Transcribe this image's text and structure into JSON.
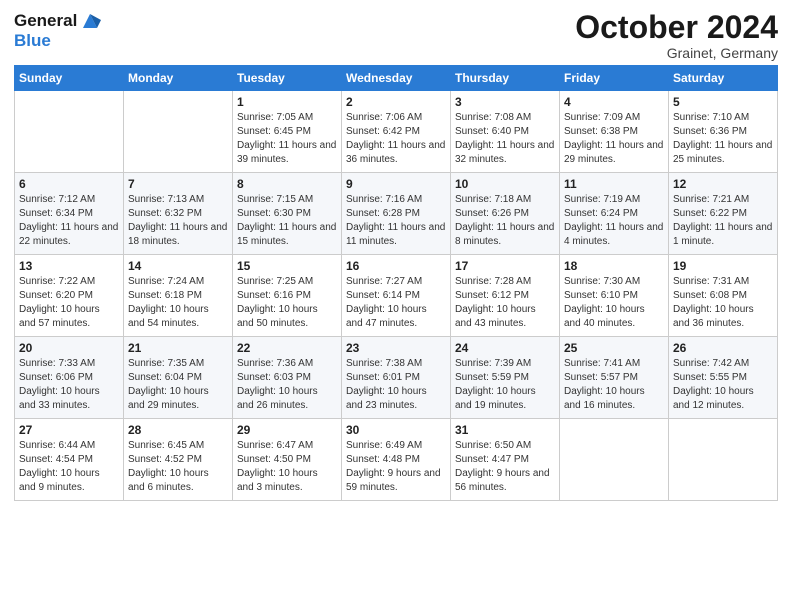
{
  "header": {
    "logo_line1": "General",
    "logo_line2": "Blue",
    "month": "October 2024",
    "location": "Grainet, Germany"
  },
  "weekdays": [
    "Sunday",
    "Monday",
    "Tuesday",
    "Wednesday",
    "Thursday",
    "Friday",
    "Saturday"
  ],
  "weeks": [
    [
      {
        "day": "",
        "content": ""
      },
      {
        "day": "",
        "content": ""
      },
      {
        "day": "1",
        "content": "Sunrise: 7:05 AM\nSunset: 6:45 PM\nDaylight: 11 hours and 39 minutes."
      },
      {
        "day": "2",
        "content": "Sunrise: 7:06 AM\nSunset: 6:42 PM\nDaylight: 11 hours and 36 minutes."
      },
      {
        "day": "3",
        "content": "Sunrise: 7:08 AM\nSunset: 6:40 PM\nDaylight: 11 hours and 32 minutes."
      },
      {
        "day": "4",
        "content": "Sunrise: 7:09 AM\nSunset: 6:38 PM\nDaylight: 11 hours and 29 minutes."
      },
      {
        "day": "5",
        "content": "Sunrise: 7:10 AM\nSunset: 6:36 PM\nDaylight: 11 hours and 25 minutes."
      }
    ],
    [
      {
        "day": "6",
        "content": "Sunrise: 7:12 AM\nSunset: 6:34 PM\nDaylight: 11 hours and 22 minutes."
      },
      {
        "day": "7",
        "content": "Sunrise: 7:13 AM\nSunset: 6:32 PM\nDaylight: 11 hours and 18 minutes."
      },
      {
        "day": "8",
        "content": "Sunrise: 7:15 AM\nSunset: 6:30 PM\nDaylight: 11 hours and 15 minutes."
      },
      {
        "day": "9",
        "content": "Sunrise: 7:16 AM\nSunset: 6:28 PM\nDaylight: 11 hours and 11 minutes."
      },
      {
        "day": "10",
        "content": "Sunrise: 7:18 AM\nSunset: 6:26 PM\nDaylight: 11 hours and 8 minutes."
      },
      {
        "day": "11",
        "content": "Sunrise: 7:19 AM\nSunset: 6:24 PM\nDaylight: 11 hours and 4 minutes."
      },
      {
        "day": "12",
        "content": "Sunrise: 7:21 AM\nSunset: 6:22 PM\nDaylight: 11 hours and 1 minute."
      }
    ],
    [
      {
        "day": "13",
        "content": "Sunrise: 7:22 AM\nSunset: 6:20 PM\nDaylight: 10 hours and 57 minutes."
      },
      {
        "day": "14",
        "content": "Sunrise: 7:24 AM\nSunset: 6:18 PM\nDaylight: 10 hours and 54 minutes."
      },
      {
        "day": "15",
        "content": "Sunrise: 7:25 AM\nSunset: 6:16 PM\nDaylight: 10 hours and 50 minutes."
      },
      {
        "day": "16",
        "content": "Sunrise: 7:27 AM\nSunset: 6:14 PM\nDaylight: 10 hours and 47 minutes."
      },
      {
        "day": "17",
        "content": "Sunrise: 7:28 AM\nSunset: 6:12 PM\nDaylight: 10 hours and 43 minutes."
      },
      {
        "day": "18",
        "content": "Sunrise: 7:30 AM\nSunset: 6:10 PM\nDaylight: 10 hours and 40 minutes."
      },
      {
        "day": "19",
        "content": "Sunrise: 7:31 AM\nSunset: 6:08 PM\nDaylight: 10 hours and 36 minutes."
      }
    ],
    [
      {
        "day": "20",
        "content": "Sunrise: 7:33 AM\nSunset: 6:06 PM\nDaylight: 10 hours and 33 minutes."
      },
      {
        "day": "21",
        "content": "Sunrise: 7:35 AM\nSunset: 6:04 PM\nDaylight: 10 hours and 29 minutes."
      },
      {
        "day": "22",
        "content": "Sunrise: 7:36 AM\nSunset: 6:03 PM\nDaylight: 10 hours and 26 minutes."
      },
      {
        "day": "23",
        "content": "Sunrise: 7:38 AM\nSunset: 6:01 PM\nDaylight: 10 hours and 23 minutes."
      },
      {
        "day": "24",
        "content": "Sunrise: 7:39 AM\nSunset: 5:59 PM\nDaylight: 10 hours and 19 minutes."
      },
      {
        "day": "25",
        "content": "Sunrise: 7:41 AM\nSunset: 5:57 PM\nDaylight: 10 hours and 16 minutes."
      },
      {
        "day": "26",
        "content": "Sunrise: 7:42 AM\nSunset: 5:55 PM\nDaylight: 10 hours and 12 minutes."
      }
    ],
    [
      {
        "day": "27",
        "content": "Sunrise: 6:44 AM\nSunset: 4:54 PM\nDaylight: 10 hours and 9 minutes."
      },
      {
        "day": "28",
        "content": "Sunrise: 6:45 AM\nSunset: 4:52 PM\nDaylight: 10 hours and 6 minutes."
      },
      {
        "day": "29",
        "content": "Sunrise: 6:47 AM\nSunset: 4:50 PM\nDaylight: 10 hours and 3 minutes."
      },
      {
        "day": "30",
        "content": "Sunrise: 6:49 AM\nSunset: 4:48 PM\nDaylight: 9 hours and 59 minutes."
      },
      {
        "day": "31",
        "content": "Sunrise: 6:50 AM\nSunset: 4:47 PM\nDaylight: 9 hours and 56 minutes."
      },
      {
        "day": "",
        "content": ""
      },
      {
        "day": "",
        "content": ""
      }
    ]
  ]
}
